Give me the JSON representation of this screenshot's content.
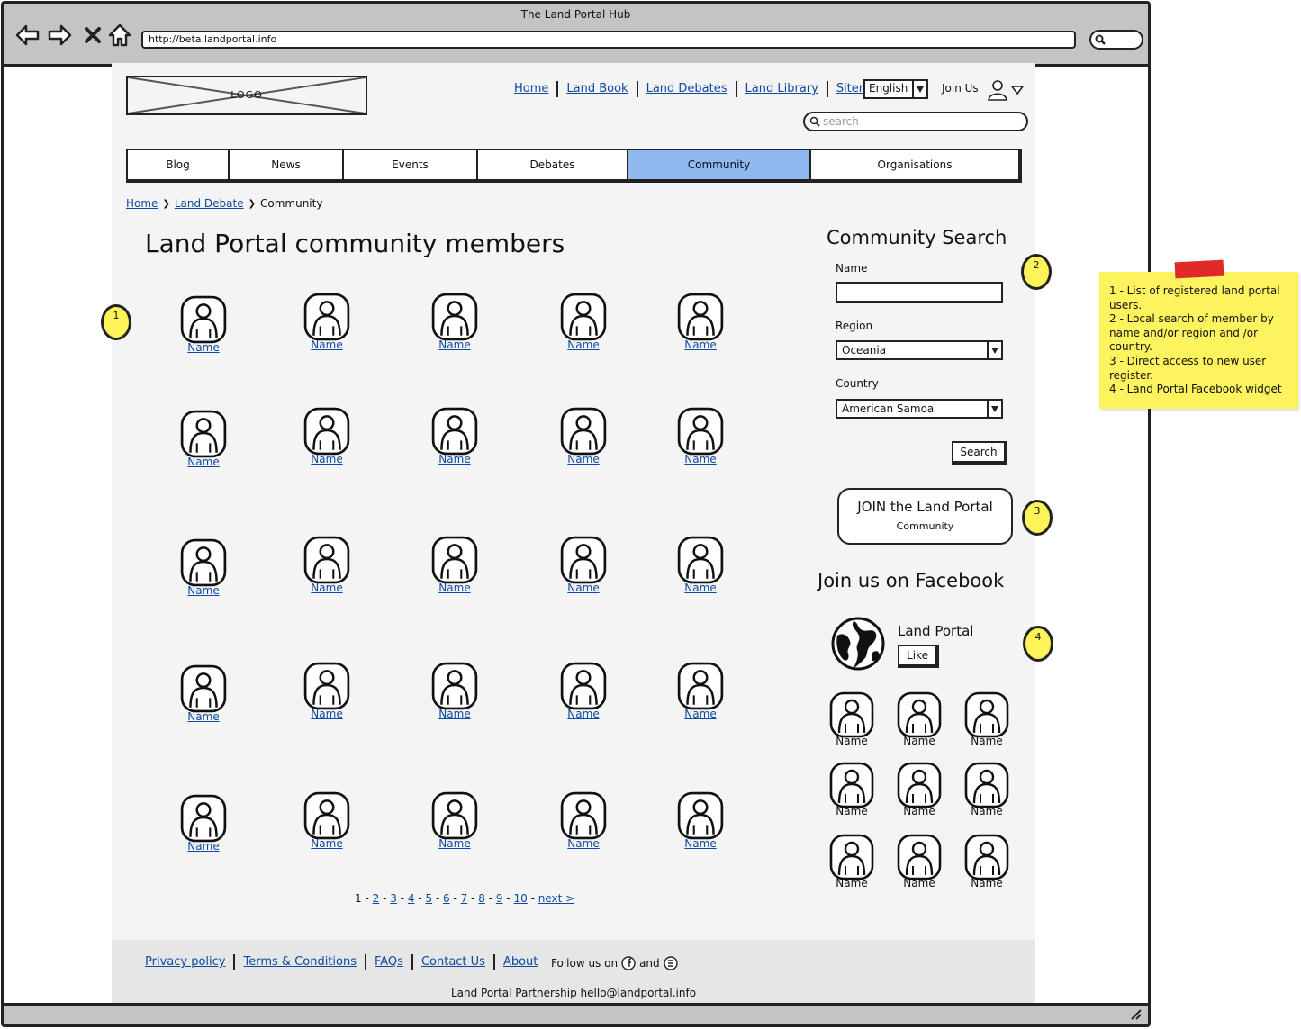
{
  "browser": {
    "window_title": "The Land Portal Hub",
    "url": "http://beta.landportal.info"
  },
  "header": {
    "logo_text": "LOGO",
    "top_links": [
      "Home",
      "Land Book",
      "Land Debates",
      "Land Library",
      "Sitemap"
    ],
    "language": "English",
    "join_us": "Join Us",
    "search_placeholder": "search"
  },
  "main_nav": [
    {
      "label": "Blog",
      "active": false
    },
    {
      "label": "News",
      "active": false
    },
    {
      "label": "Events",
      "active": false
    },
    {
      "label": "Debates",
      "active": false
    },
    {
      "label": "Community",
      "active": true
    },
    {
      "label": "Organisations",
      "active": false
    }
  ],
  "breadcrumb": {
    "items": [
      "Home",
      "Land Debate"
    ],
    "current": "Community"
  },
  "page_title": "Land Portal community members",
  "members": {
    "name_label": "Name",
    "rows": 5,
    "columns": 5
  },
  "pagination": {
    "current": "1",
    "pages": [
      "2",
      "3",
      "4",
      "5",
      "6",
      "7",
      "8",
      "9",
      "10"
    ],
    "next": "next >"
  },
  "community_search": {
    "title": "Community Search",
    "name_label": "Name",
    "name_value": "",
    "region_label": "Region",
    "region_value": "Oceania",
    "country_label": "Country",
    "country_value": "American Samoa",
    "search_button": "Search"
  },
  "join": {
    "line1": "JOIN the Land Portal",
    "line2": "Community"
  },
  "facebook": {
    "title": "Join us on Facebook",
    "page_name": "Land Portal",
    "like_button": "Like",
    "fan_label": "Name"
  },
  "footer": {
    "links": [
      "Privacy policy",
      "Terms & Conditions",
      "FAQs",
      "Contact Us",
      "About"
    ],
    "follow_text": "Follow us on",
    "and_text": "and",
    "partnership": "Land Portal Partnership hello@landportal.info"
  },
  "annotations": {
    "bubbles": [
      "1",
      "2",
      "3",
      "4"
    ],
    "note_lines": [
      "1 - List of registered land portal",
      "users.",
      "2 - Local search of member by",
      "name and/or region and /or",
      "country.",
      "3 - Direct access to new user",
      "register.",
      "4 - Land Portal Facebook widget"
    ],
    "note_color": "#fdf35f",
    "accent_color": "#8fb8ee"
  }
}
